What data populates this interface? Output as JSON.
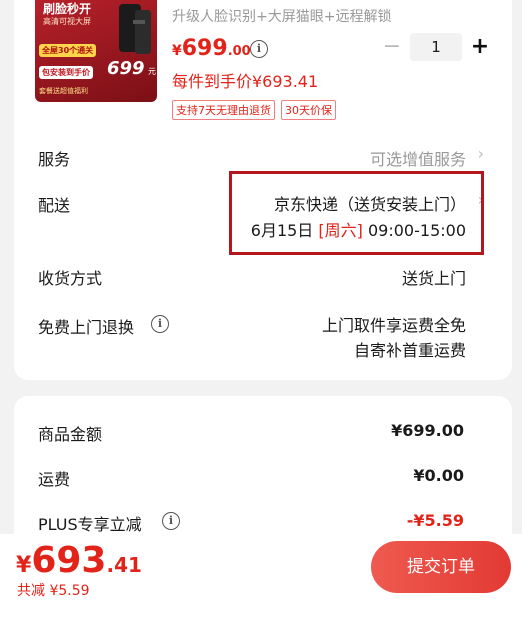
{
  "product": {
    "image_text": {
      "headline": "刷脸秒开",
      "sub": "高清可视大屏",
      "badge1": "全屋30个通关",
      "badge2": "包安装到手价",
      "price_text": "699",
      "price_unit": "元",
      "badge3": "套餐送超值福利"
    },
    "spec": "升级人脸识别+大屏猫眼+远程解锁",
    "price_symbol": "¥",
    "price_int": "699",
    "price_dec": ".00",
    "quantity": "1",
    "minus_glyph": "−",
    "plus_glyph": "+",
    "each_price": "每件到手价¥693.41",
    "tags": [
      "支持7天无理由退货",
      "30天价保"
    ]
  },
  "rows": {
    "service_label": "服务",
    "service_value": "可选增值服务",
    "delivery_label": "配送",
    "delivery_line1": "京东快递（送货安装上门）",
    "delivery_date": "6月15日",
    "delivery_weekday": "[周六]",
    "delivery_time": "09:00-15:00",
    "receive_label": "收货方式",
    "receive_value": "送货上门",
    "return_label": "免费上门退换",
    "return_line1": "上门取件享运费全免",
    "return_line2": "自寄补首重运费",
    "chevron": "›"
  },
  "summary": {
    "goods_label": "商品金额",
    "goods_value": "¥699.00",
    "shipping_label": "运费",
    "shipping_value": "¥0.00",
    "plus_label": "PLUS专享立减",
    "plus_value": "-¥5.59"
  },
  "footer": {
    "total_symbol": "¥",
    "total_int": "693",
    "total_dec": ".41",
    "saved": "共减 ¥5.59",
    "submit_label": "提交订单"
  },
  "colors": {
    "accent": "#e2231a",
    "highlight_box": "#b3161c"
  }
}
